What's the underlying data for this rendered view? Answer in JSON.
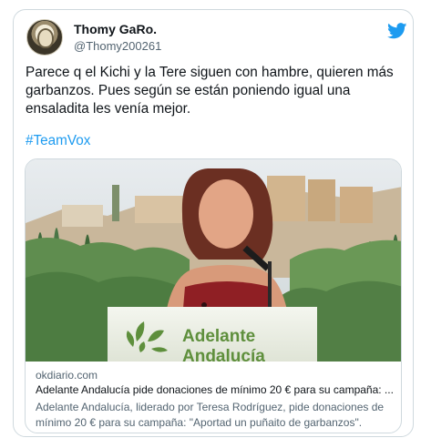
{
  "tweet": {
    "display_name": "Thomy GaRo.",
    "handle": "@Thomy200261",
    "text": "Parece q el Kichi y la Tere siguen con hambre, quieren más garbanzos. Pues según se están poniendo igual una ensaladita les venía mejor.",
    "hashtag": "#TeamVox"
  },
  "card": {
    "domain": "okdiario.com",
    "title": "Adelante Andalucía pide donaciones de mínimo 20 € para su campaña: ...",
    "description": "Adelante Andalucía, liderado por Teresa Rodríguez, pide donaciones de mínimo 20 € para su campaña: \"Aportad un puñaito de garbanzos\".",
    "image": {
      "podium_line1": "Adelante",
      "podium_line2": "Andalucía"
    }
  },
  "icons": {
    "brand": "twitter-bird-icon",
    "brand_color": "#1d9bf0",
    "podium_logo_color": "#5e8f3c"
  }
}
